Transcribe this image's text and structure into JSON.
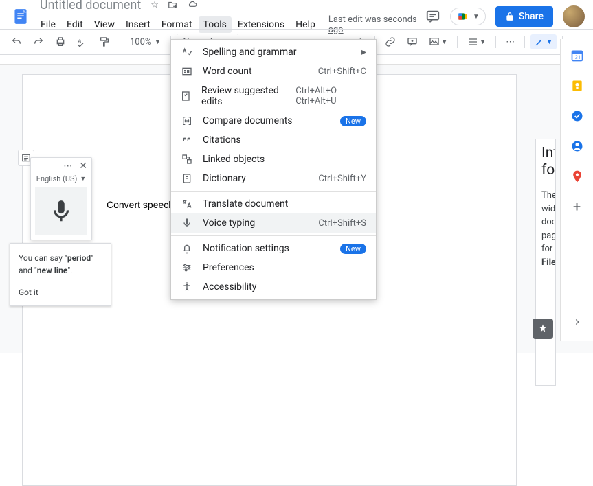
{
  "doc_title": "Untitled document",
  "menus": {
    "file": "File",
    "edit": "Edit",
    "view": "View",
    "insert": "Insert",
    "format": "Format",
    "tools": "Tools",
    "extensions": "Extensions",
    "help": "Help"
  },
  "last_edit": "Last edit was seconds ago",
  "share": "Share",
  "zoom": "100%",
  "paragraph_style": "Normal",
  "doc_body_text": "Convert speech to",
  "voice_panel": {
    "language": "English (US)"
  },
  "tooltip": {
    "pre": "You can say \"",
    "b1": "period",
    "mid": "\" and \"",
    "b2": "new line",
    "post": "\".",
    "got_it": "Got it"
  },
  "tools_menu": {
    "spelling": "Spelling and grammar",
    "wordcount": {
      "label": "Word count",
      "shortcut": "Ctrl+Shift+C"
    },
    "review": {
      "label": "Review suggested edits",
      "shortcut": "Ctrl+Alt+O Ctrl+Alt+U"
    },
    "compare": "Compare documents",
    "citations": "Citations",
    "linked": "Linked objects",
    "dictionary": {
      "label": "Dictionary",
      "shortcut": "Ctrl+Shift+Y"
    },
    "translate": "Translate document",
    "voice": {
      "label": "Voice typing",
      "shortcut": "Ctrl+Shift+S"
    },
    "notif": "Notification settings",
    "prefs": "Preferences",
    "a11y": "Accessibility",
    "new_badge": "New"
  },
  "side_panel": {
    "title_l1": "Int",
    "title_l2": "fo",
    "body": "The\nwid\ndoc\npag\nfor",
    "bold": "File"
  }
}
